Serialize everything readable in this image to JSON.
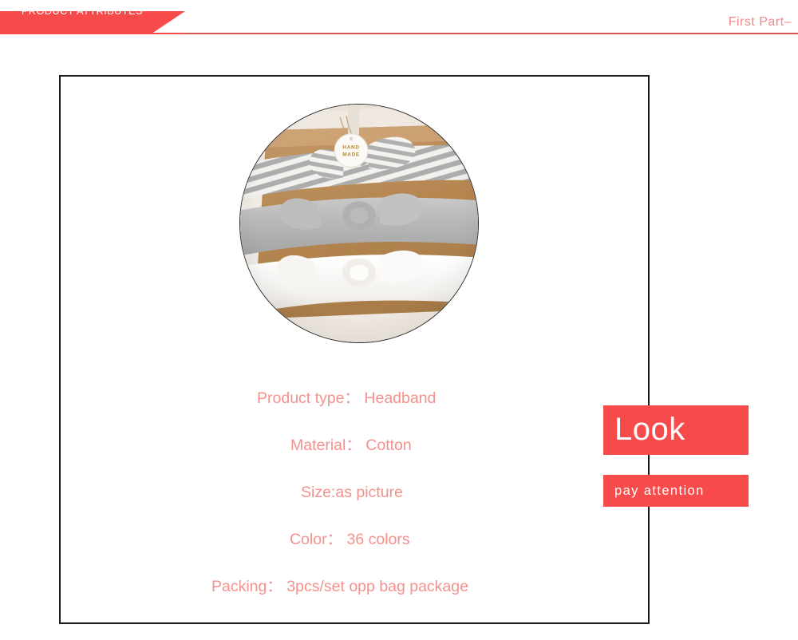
{
  "header": {
    "banner_label": "PRODUCT ATTRIBUTES",
    "right_label": "First Part–",
    "accent_color": "#f74a4a",
    "rule_color": "#d6564f",
    "right_label_color": "#f08a88"
  },
  "product_photo": {
    "alt": "Three knotted bow headbands laid on kraft paper: grey-and-white striped, heather grey, and white",
    "tag_line_1": "HAND",
    "tag_line_2": "MADE",
    "shape": "circle"
  },
  "attributes": [
    {
      "label": "Product type：",
      "value": "Headband"
    },
    {
      "label": "Material：",
      "value": "Cotton"
    },
    {
      "label": "Size:",
      "value": "as picture"
    },
    {
      "label": "Color：",
      "value": "36 colors"
    },
    {
      "label": "Packing：",
      "value": "3pcs/set opp bag package"
    }
  ],
  "attribute_lines": [
    "Product type： Headband",
    "Material： Cotton",
    "Size:as picture",
    "Color： 36 colors",
    "Packing： 3pcs/set opp bag package"
  ],
  "attribute_text_color": "#f4918d",
  "callouts": {
    "look_label": "Look",
    "attention_label": "pay attention",
    "background_color": "#f74a4a",
    "text_color": "#ffffff"
  },
  "frame": {
    "border_color": "#1a1a1a"
  }
}
